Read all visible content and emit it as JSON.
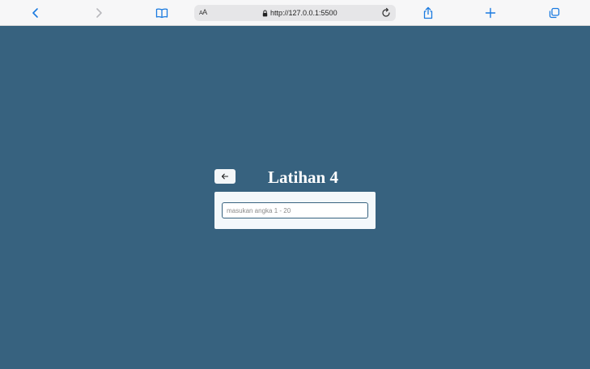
{
  "browser": {
    "text_size_label_small": "A",
    "text_size_label_large": "A",
    "url": "http://127.0.0.1:5500",
    "icons": {
      "back": "chevron-left-icon",
      "forward": "chevron-right-icon",
      "bookmarks": "book-icon",
      "lock": "lock-icon",
      "reload": "reload-icon",
      "share": "share-icon",
      "new_tab": "plus-icon",
      "tabs": "tabs-icon"
    },
    "colors": {
      "accent": "#1a7ae0",
      "disabled": "#b9b9bd"
    }
  },
  "page": {
    "background_color": "#37627f",
    "title": "Latihan 4",
    "back_button_icon": "arrow-left-icon",
    "input": {
      "value": "",
      "placeholder": "masukan angka 1 - 20"
    }
  }
}
